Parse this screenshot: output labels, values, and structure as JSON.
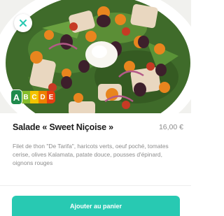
{
  "product": {
    "name": "Salade « Sweet Niçoise »",
    "price": "16,00 €",
    "description": "Filet de thon \"De Tarifa\", haricots verts, oeuf poché, tomates cerise, olives Kalamata, patate douce, pousses d'épinard, oignons rouges"
  },
  "nutriscore": {
    "grades": [
      "A",
      "B",
      "C",
      "D",
      "E"
    ],
    "selected": "A",
    "colors": [
      "#1f8a4c",
      "#86bc2b",
      "#f3c300",
      "#ee8100",
      "#e63e11"
    ]
  },
  "icons": {
    "close": "close-icon"
  },
  "actions": {
    "add_to_cart_label": "Ajouter au panier"
  },
  "colors": {
    "accent": "#28c9b2",
    "close_icon": "#28c9b2"
  }
}
